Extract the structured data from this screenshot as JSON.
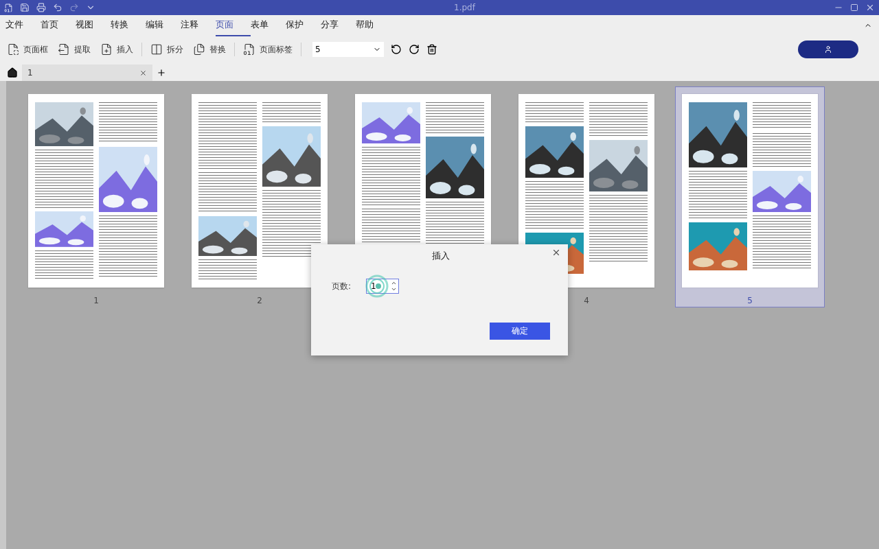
{
  "window": {
    "title": "1.pdf"
  },
  "menu": [
    {
      "label": "文件",
      "selected": false
    },
    {
      "label": "首页",
      "selected": false
    },
    {
      "label": "视图",
      "selected": false
    },
    {
      "label": "转换",
      "selected": false
    },
    {
      "label": "编辑",
      "selected": false
    },
    {
      "label": "注释",
      "selected": false
    },
    {
      "label": "页面",
      "selected": true
    },
    {
      "label": "表单",
      "selected": false
    },
    {
      "label": "保护",
      "selected": false
    },
    {
      "label": "分享",
      "selected": false
    },
    {
      "label": "帮助",
      "selected": false
    }
  ],
  "toolbar": {
    "items": [
      {
        "label": "页面框"
      },
      {
        "label": "提取"
      },
      {
        "label": "插入"
      },
      {
        "label": "拆分"
      },
      {
        "label": "替换"
      },
      {
        "label": "页面标签"
      }
    ],
    "page_select": {
      "value": "5"
    }
  },
  "tabs": [
    {
      "label": "1",
      "selected": true
    }
  ],
  "pages": [
    {
      "label": "1",
      "selected": false
    },
    {
      "label": "2",
      "selected": false
    },
    {
      "selected": false
    },
    {
      "label": "4",
      "selected": false
    },
    {
      "label": "5",
      "selected": true
    }
  ],
  "dialog": {
    "title": "插入",
    "field_label": "页数:",
    "value": "1",
    "confirm": "确定"
  }
}
